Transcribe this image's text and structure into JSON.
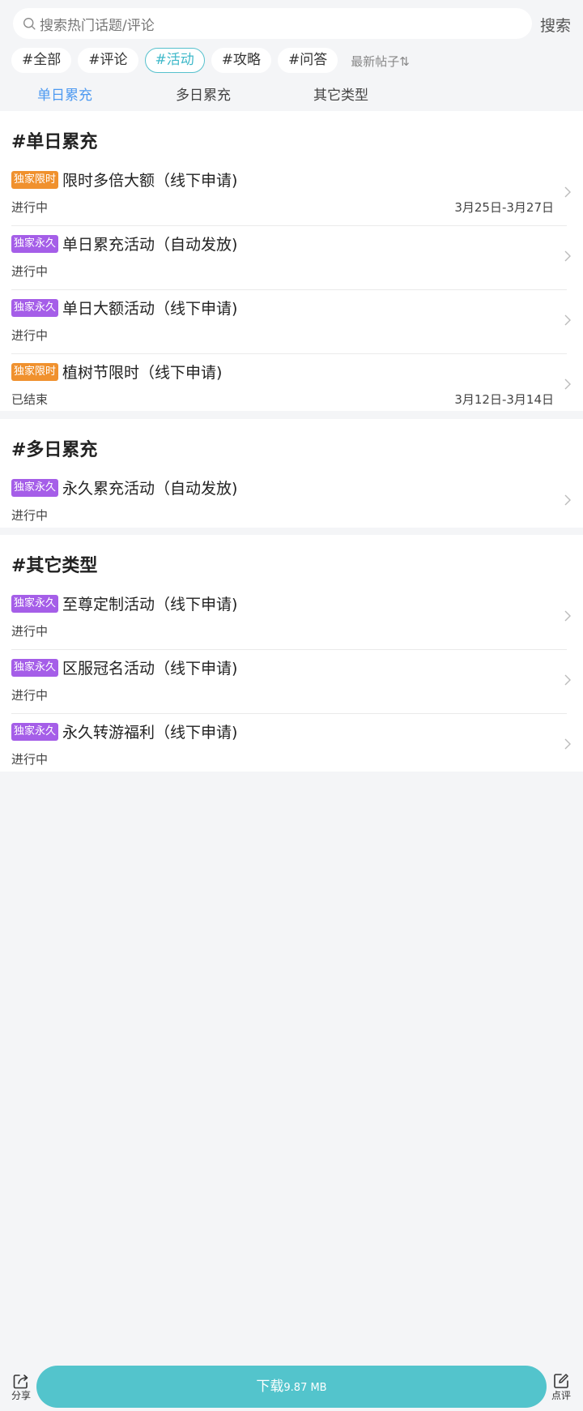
{
  "search": {
    "placeholder": "搜索热门话题/评论",
    "button_label": "搜索"
  },
  "tags": [
    {
      "label": "#全部",
      "active": false
    },
    {
      "label": "#评论",
      "active": false
    },
    {
      "label": "#活动",
      "active": true
    },
    {
      "label": "#攻略",
      "active": false
    },
    {
      "label": "#问答",
      "active": false
    }
  ],
  "sort": {
    "label": "最新帖子⇅"
  },
  "subtabs": [
    {
      "label": "单日累充",
      "active": true
    },
    {
      "label": "多日累充",
      "active": false
    },
    {
      "label": "其它类型",
      "active": false
    }
  ],
  "sections": [
    {
      "title": "#单日累充",
      "items": [
        {
          "badge": "独家限时",
          "badge_type": "limited",
          "title": "限时多倍大额（线下申请)",
          "status": "进行中",
          "date": "3月25日-3月27日"
        },
        {
          "badge": "独家永久",
          "badge_type": "forever",
          "title": "单日累充活动（自动发放)",
          "status": "进行中",
          "date": ""
        },
        {
          "badge": "独家永久",
          "badge_type": "forever",
          "title": "单日大额活动（线下申请)",
          "status": "进行中",
          "date": ""
        },
        {
          "badge": "独家限时",
          "badge_type": "limited",
          "title": "植树节限时（线下申请)",
          "status": "已结束",
          "date": "3月12日-3月14日"
        }
      ]
    },
    {
      "title": "#多日累充",
      "items": [
        {
          "badge": "独家永久",
          "badge_type": "forever",
          "title": "永久累充活动（自动发放)",
          "status": "进行中",
          "date": ""
        }
      ]
    },
    {
      "title": "#其它类型",
      "items": [
        {
          "badge": "独家永久",
          "badge_type": "forever",
          "title": "至尊定制活动（线下申请)",
          "status": "进行中",
          "date": ""
        },
        {
          "badge": "独家永久",
          "badge_type": "forever",
          "title": "区服冠名活动（线下申请)",
          "status": "进行中",
          "date": ""
        },
        {
          "badge": "独家永久",
          "badge_type": "forever",
          "title": "永久转游福利（线下申请)",
          "status": "进行中",
          "date": ""
        }
      ]
    }
  ],
  "bottom": {
    "share_label": "分享",
    "download_label": "下载",
    "download_size": "9.87 MB",
    "review_label": "点评"
  },
  "colors": {
    "accent": "#53c4cc",
    "tab_active": "#4e9af1",
    "badge_limited": "#f0912e",
    "badge_forever": "#a55ee8"
  }
}
